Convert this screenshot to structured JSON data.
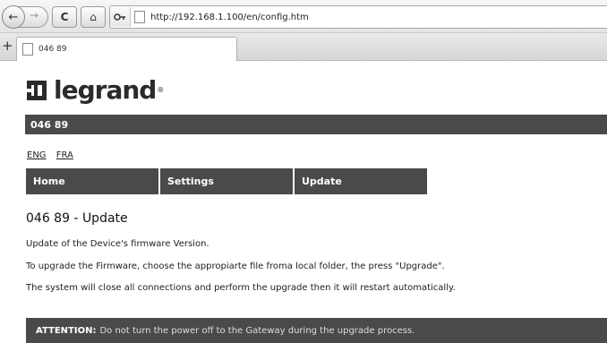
{
  "browser": {
    "url": "http://192.168.1.100/en/config.htm",
    "tab_title": "046 89",
    "new_tab_symbol": "+",
    "back_symbol": "←",
    "forward_symbol": "→",
    "reload_symbol": "C",
    "home_symbol": "⌂"
  },
  "brand": {
    "name": "legrand",
    "reg_mark": "®"
  },
  "header": {
    "device_id": "046 89"
  },
  "languages": [
    "ENG",
    "FRA"
  ],
  "menu": [
    "Home",
    "Settings",
    "Update"
  ],
  "main": {
    "title": "046 89 - Update",
    "paragraphs": [
      "Update of the Device's firmware Version.",
      "To upgrade the Firmware, choose the appropiarte file froma local folder, the press \"Upgrade\".",
      "The system will close all connections and perform the upgrade then it will restart automatically."
    ]
  },
  "attention": {
    "label": "ATTENTION:",
    "text": "Do not turn the power off to the Gateway during the upgrade process."
  },
  "colors": {
    "dark_bar": "#4a4a4a"
  }
}
